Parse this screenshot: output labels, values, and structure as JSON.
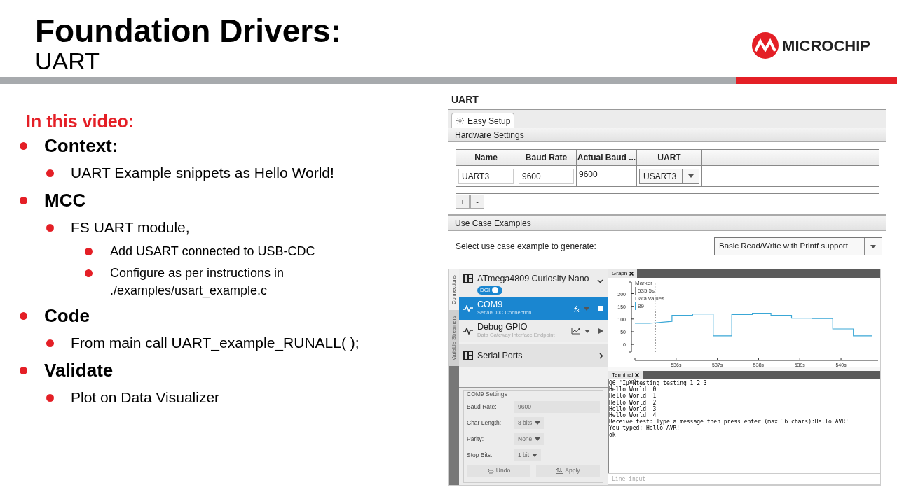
{
  "slide": {
    "title": "Foundation Drivers:",
    "subtitle": "UART",
    "logo_text": "MICROCHIP"
  },
  "outline": {
    "heading": "In this video:",
    "items": [
      {
        "text": "Context:",
        "children": [
          {
            "text": "UART Example snippets as Hello World!"
          }
        ]
      },
      {
        "text": "MCC",
        "children": [
          {
            "text": "FS UART module,",
            "children": [
              {
                "text": "Add USART connected to USB-CDC"
              },
              {
                "text": "Configure as per instructions in ./examples/usart_example.c"
              }
            ]
          }
        ]
      },
      {
        "text": "Code",
        "children": [
          {
            "text": "From main call UART_example_RUNALL( );"
          }
        ]
      },
      {
        "text": "Validate",
        "children": [
          {
            "text": "Plot on Data Visualizer"
          }
        ]
      }
    ]
  },
  "mcc_panel": {
    "title": "UART",
    "tabs": [
      {
        "label": "Easy Setup",
        "selected": true
      }
    ],
    "hardware_section": "Hardware Settings",
    "table": {
      "columns": [
        "Name",
        "Baud Rate",
        "Actual Baud ...",
        "UART"
      ],
      "rows": [
        [
          {
            "kind": "input",
            "value": "UART3"
          },
          {
            "kind": "input",
            "value": "9600"
          },
          {
            "kind": "text",
            "value": "9600"
          },
          {
            "kind": "select",
            "value": "USART3"
          }
        ]
      ]
    },
    "add_button": "+",
    "remove_button": "-",
    "use_case_section": "Use Case Examples",
    "use_case_label": "Select use case example to generate:",
    "use_case_value": "Basic Read/Write with Printf support"
  },
  "data_visualizer": {
    "side_tabs": [
      {
        "label": "Connections",
        "selected": true
      },
      {
        "label": "Variable Streamers",
        "selected": false
      }
    ],
    "connections": [
      {
        "kind": "device",
        "name": "ATmega4809 Curiosity Nano",
        "toggle_label": "DGI",
        "toggle_on": true,
        "selected": false
      },
      {
        "kind": "endpoint",
        "name": "COM9",
        "subtitle": "Serial/CDC Connection",
        "selected": true
      },
      {
        "kind": "endpoint",
        "name": "Debug GPIO",
        "subtitle": "Data Gateway Interface Endpoint",
        "selected": false
      },
      {
        "kind": "group",
        "name": "Serial Ports",
        "selected": false
      }
    ],
    "settings": {
      "title": "COM9 Settings",
      "fields": [
        {
          "kind": "input",
          "label": "Baud Rate:",
          "value": "9600"
        },
        {
          "kind": "select",
          "label": "Char Length:",
          "value": "8 bits"
        },
        {
          "kind": "select",
          "label": "Parity:",
          "value": "None"
        },
        {
          "kind": "select",
          "label": "Stop Bits:",
          "value": "1 bit"
        }
      ],
      "buttons": [
        {
          "kind": "undo",
          "label": "Undo",
          "disabled": true
        },
        {
          "kind": "apply",
          "label": "Apply",
          "disabled": true
        }
      ]
    },
    "graph": {
      "tab": "Graph",
      "marker_label": "Marker",
      "marker_value": "535.5s",
      "data_value": "89",
      "chart_data": {
        "type": "line",
        "ref_lines": [
          {
            "axis": "x",
            "value": 535.5,
            "color": "#999999"
          }
        ],
        "xlim": [
          535,
          540.9
        ],
        "ylim": [
          -30,
          240
        ],
        "yticks": [
          0,
          50,
          100,
          150,
          200
        ],
        "xticks": [
          {
            "value": 536,
            "label": "536s"
          },
          {
            "value": 537,
            "label": "537s"
          },
          {
            "value": 538,
            "label": "538s"
          },
          {
            "value": 539,
            "label": "539s"
          },
          {
            "value": 540,
            "label": "540s"
          }
        ],
        "x": [
          535,
          535.35,
          535.9,
          535.9,
          536.4,
          536.4,
          536.9,
          536.9,
          537.35,
          537.35,
          537.85,
          537.85,
          538.3,
          538.3,
          538.8,
          538.8,
          539.3,
          539.3,
          539.8,
          539.8,
          540.3,
          540.3,
          540.75
        ],
        "series": [
          {
            "name": "Data values",
            "color": "#3aa7d6",
            "values": [
              83,
              83,
              91,
              114,
              114,
              120,
              120,
              34,
              34,
              118,
              118,
              123,
              123,
              114,
              114,
              103,
              103,
              102,
              102,
              61,
              61,
              34,
              34
            ]
          }
        ]
      }
    },
    "terminal": {
      "tab": "Terminal",
      "lines": [
        "QЄ_'Iµ¥Ñtesting testing 1 2 3",
        "Hello World! 0",
        "Hello World! 1",
        "Hello World! 2",
        "Hello World! 3",
        "Hello World! 4",
        "Receive test: Type a message then press enter (max 16 chars):Hello AVR!",
        "You typed: Hello AVR!",
        "ok"
      ],
      "placeholder": "Line input"
    }
  }
}
